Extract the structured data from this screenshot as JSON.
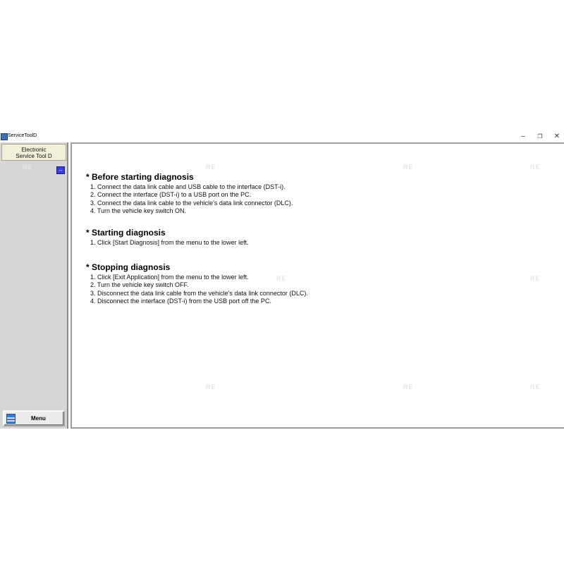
{
  "window": {
    "title": "ServiceToolD",
    "controls": {
      "minimize": "–",
      "maximize": "❐",
      "close": "✕"
    }
  },
  "sidebar": {
    "header_line1": "Electronic",
    "header_line2": "Service Tool D",
    "swap_icon": "swap-arrows-icon",
    "menu_label": "Menu"
  },
  "content": {
    "sections": [
      {
        "title": "* Before starting diagnosis",
        "steps": [
          "1. Connect the data link cable and USB cable to the interface (DST-i).",
          "2. Connect the interface (DST-i) to a USB port on the PC.",
          "3. Connect the data link cable to the vehicle's data link connector (DLC).",
          "4. Turn the vehicle key switch ON."
        ]
      },
      {
        "title": "* Starting diagnosis",
        "steps": [
          "1. Click [Start Diagnosis] from the menu to the lower left."
        ]
      },
      {
        "title": "* Stopping diagnosis",
        "steps": [
          "1. Click [Exit Application] from the menu to the lower left.",
          "2. Turn the vehicle key switch OFF.",
          "3. Disconnect the data link cable from the vehicle's data link connector (DLC).",
          "4. Disconnect the interface (DST-i) from the USB port off the PC."
        ]
      }
    ]
  },
  "watermark_text": "RE",
  "colors": {
    "swap_button": "#3b3bd8",
    "header_bg": "#f1efd8",
    "sidebar_bg": "#d6d6d6"
  }
}
